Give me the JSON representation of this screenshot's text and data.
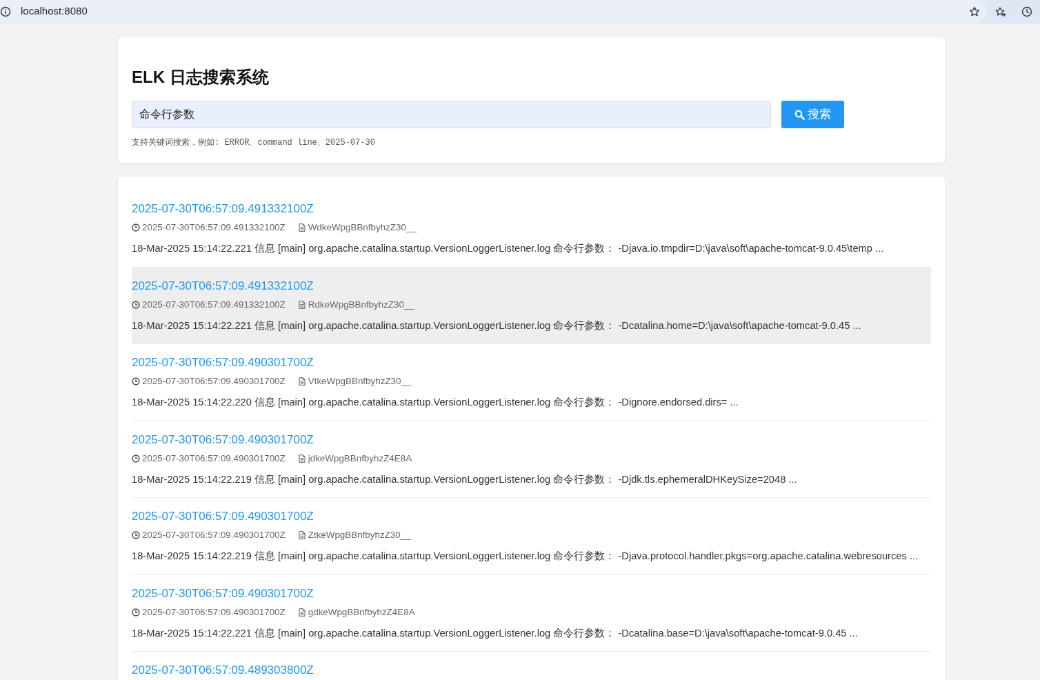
{
  "browser": {
    "url": "localhost:8080"
  },
  "header": {
    "title": "ELK 日志搜索系统",
    "search": {
      "value": "命令行参数",
      "button": "搜索"
    },
    "hint": "支持关键词搜索，例如: ERROR、command line、2025-07-30"
  },
  "results": [
    {
      "title": "2025-07-30T06:57:09.491332100Z",
      "timestamp": "2025-07-30T06:57:09.491332100Z",
      "doc_id": "WdkeWpgBBnfbyhzZ30__",
      "message": "18-Mar-2025 15:14:22.221 信息 [main] org.apache.catalina.startup.VersionLoggerListener.log 命令行参数： -Djava.io.tmpdir=D:\\java\\soft\\apache-tomcat-9.0.45\\temp ...",
      "hovered": false
    },
    {
      "title": "2025-07-30T06:57:09.491332100Z",
      "timestamp": "2025-07-30T06:57:09.491332100Z",
      "doc_id": "RdkeWpgBBnfbyhzZ30__",
      "message": "18-Mar-2025 15:14:22.221 信息 [main] org.apache.catalina.startup.VersionLoggerListener.log 命令行参数： -Dcatalina.home=D:\\java\\soft\\apache-tomcat-9.0.45 ...",
      "hovered": true
    },
    {
      "title": "2025-07-30T06:57:09.490301700Z",
      "timestamp": "2025-07-30T06:57:09.490301700Z",
      "doc_id": "VtkeWpgBBnfbyhzZ30__",
      "message": "18-Mar-2025 15:14:22.220 信息 [main] org.apache.catalina.startup.VersionLoggerListener.log 命令行参数： -Dignore.endorsed.dirs= ...",
      "hovered": false
    },
    {
      "title": "2025-07-30T06:57:09.490301700Z",
      "timestamp": "2025-07-30T06:57:09.490301700Z",
      "doc_id": "jdkeWpgBBnfbyhzZ4E8A",
      "message": "18-Mar-2025 15:14:22.219 信息 [main] org.apache.catalina.startup.VersionLoggerListener.log 命令行参数： -Djdk.tls.ephemeralDHKeySize=2048 ...",
      "hovered": false
    },
    {
      "title": "2025-07-30T06:57:09.490301700Z",
      "timestamp": "2025-07-30T06:57:09.490301700Z",
      "doc_id": "ZtkeWpgBBnfbyhzZ30__",
      "message": "18-Mar-2025 15:14:22.219 信息 [main] org.apache.catalina.startup.VersionLoggerListener.log 命令行参数： -Djava.protocol.handler.pkgs=org.apache.catalina.webresources ...",
      "hovered": false
    },
    {
      "title": "2025-07-30T06:57:09.490301700Z",
      "timestamp": "2025-07-30T06:57:09.490301700Z",
      "doc_id": "gdkeWpgBBnfbyhzZ4E8A",
      "message": "18-Mar-2025 15:14:22.221 信息 [main] org.apache.catalina.startup.VersionLoggerListener.log 命令行参数： -Dcatalina.base=D:\\java\\soft\\apache-tomcat-9.0.45 ...",
      "hovered": false
    },
    {
      "title": "2025-07-30T06:57:09.489303800Z",
      "hovered": false
    }
  ]
}
